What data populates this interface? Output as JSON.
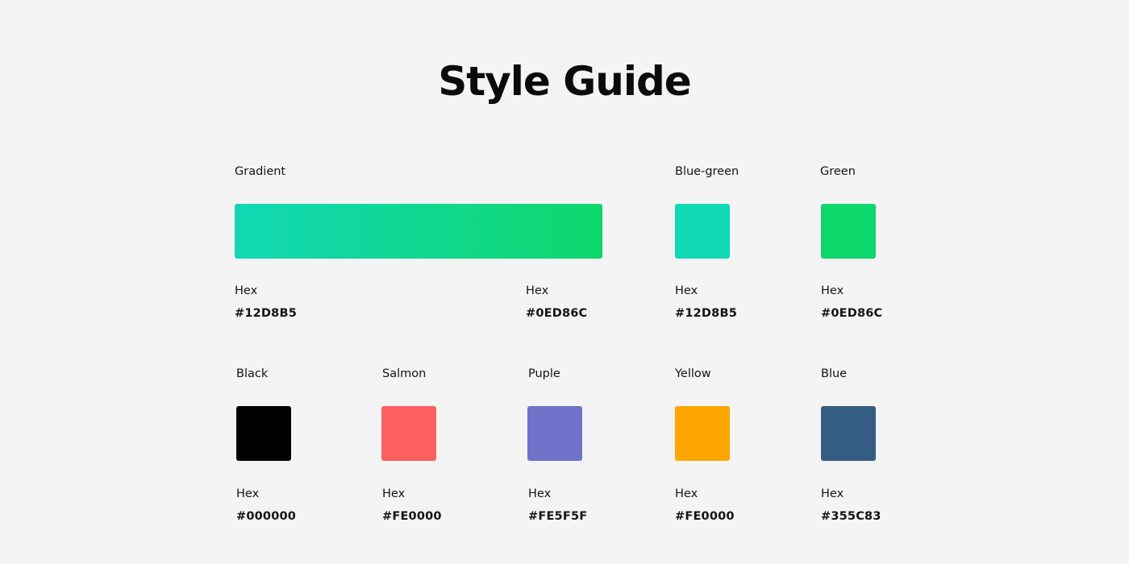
{
  "title": "Style Guide",
  "gradient": {
    "label": "Gradient",
    "start": {
      "hex_caption": "Hex",
      "hex": "#12D8B5"
    },
    "end": {
      "hex_caption": "Hex",
      "hex": "#0ED86C"
    },
    "color_start": "#12D8B5",
    "color_end": "#0ED86C"
  },
  "row1": [
    {
      "name": "Blue-green",
      "hex_caption": "Hex",
      "hex": "#12D8B5",
      "color": "#12D8B5"
    },
    {
      "name": "Green",
      "hex_caption": "Hex",
      "hex": "#0ED86C",
      "color": "#0ED86C"
    }
  ],
  "row2": [
    {
      "name": "Black",
      "hex_caption": "Hex",
      "hex": "#000000",
      "color": "#000000"
    },
    {
      "name": "Salmon",
      "hex_caption": "Hex",
      "hex": "#FE0000",
      "color": "#FE5F5F"
    },
    {
      "name": "Puple",
      "hex_caption": "Hex",
      "hex": "#FE5F5F",
      "color": "#6F73C9"
    },
    {
      "name": "Yellow",
      "hex_caption": "Hex",
      "hex": "#FE0000",
      "color": "#FEA500"
    },
    {
      "name": "Blue",
      "hex_caption": "Hex",
      "hex": "#355C83",
      "color": "#355C83"
    }
  ]
}
